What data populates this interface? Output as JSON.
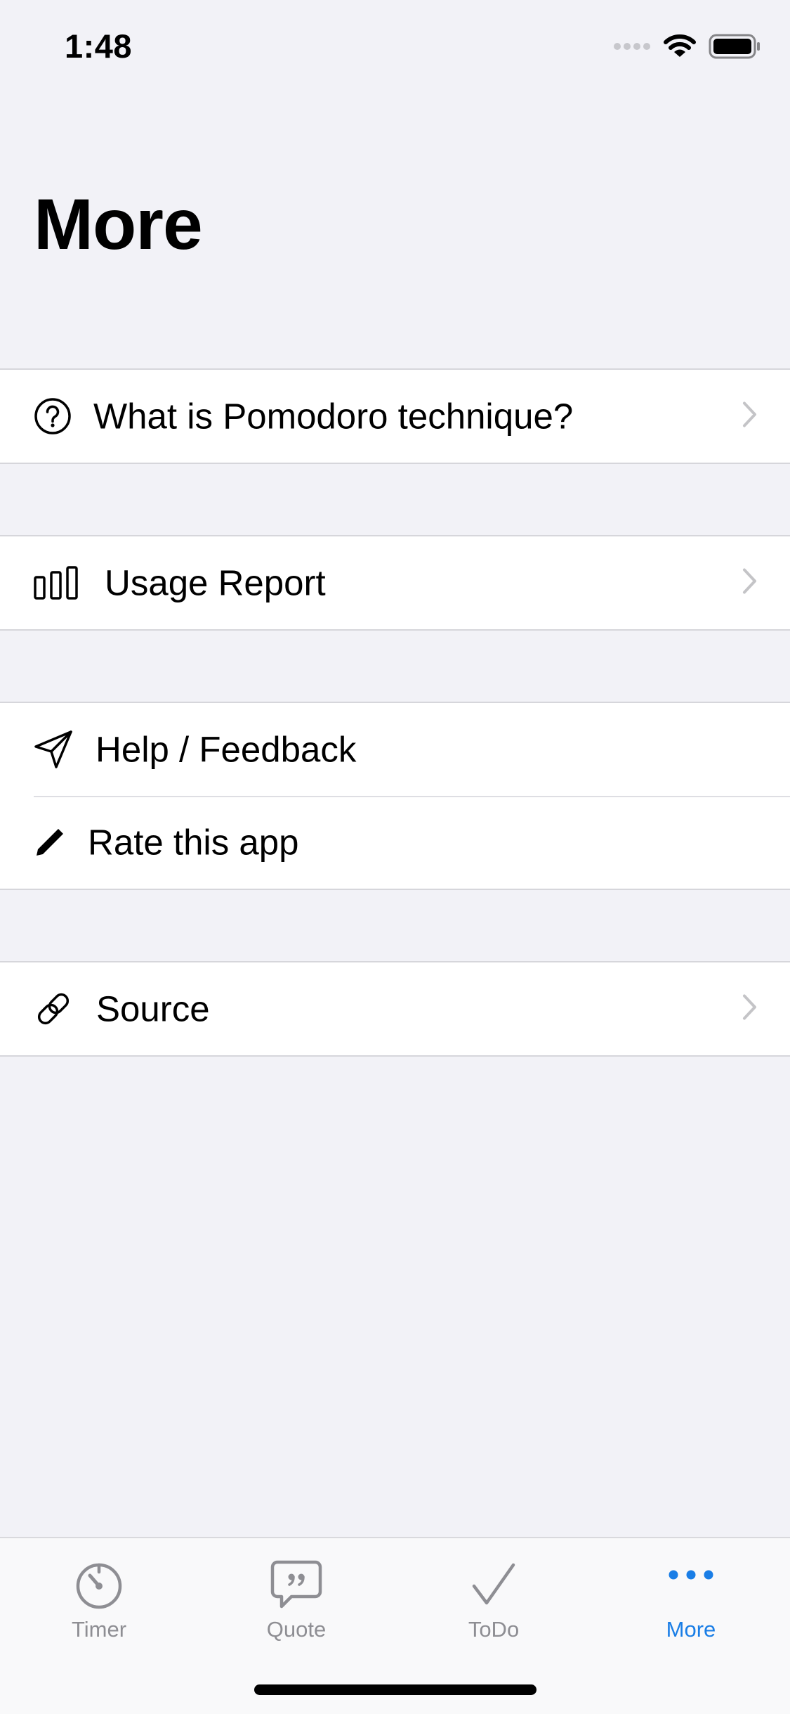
{
  "status_bar": {
    "time": "1:48"
  },
  "page": {
    "title": "More"
  },
  "menu": {
    "pomodoro_label": "What is Pomodoro technique?",
    "usage_label": "Usage Report",
    "help_label": "Help / Feedback",
    "rate_label": "Rate this app",
    "source_label": "Source"
  },
  "tab_bar": {
    "timer": "Timer",
    "quote": "Quote",
    "todo": "ToDo",
    "more": "More"
  },
  "colors": {
    "accent": "#1a7ee6",
    "inactive": "#8e8e93",
    "background": "#f2f2f7"
  },
  "icons": {
    "pomodoro": "question-circle-icon",
    "usage": "bar-chart-icon",
    "help": "paper-plane-icon",
    "rate": "pencil-icon",
    "source": "link-icon",
    "timer_tab": "timer-icon",
    "quote_tab": "quote-bubble-icon",
    "todo_tab": "checkmark-icon",
    "more_tab": "ellipsis-icon"
  }
}
